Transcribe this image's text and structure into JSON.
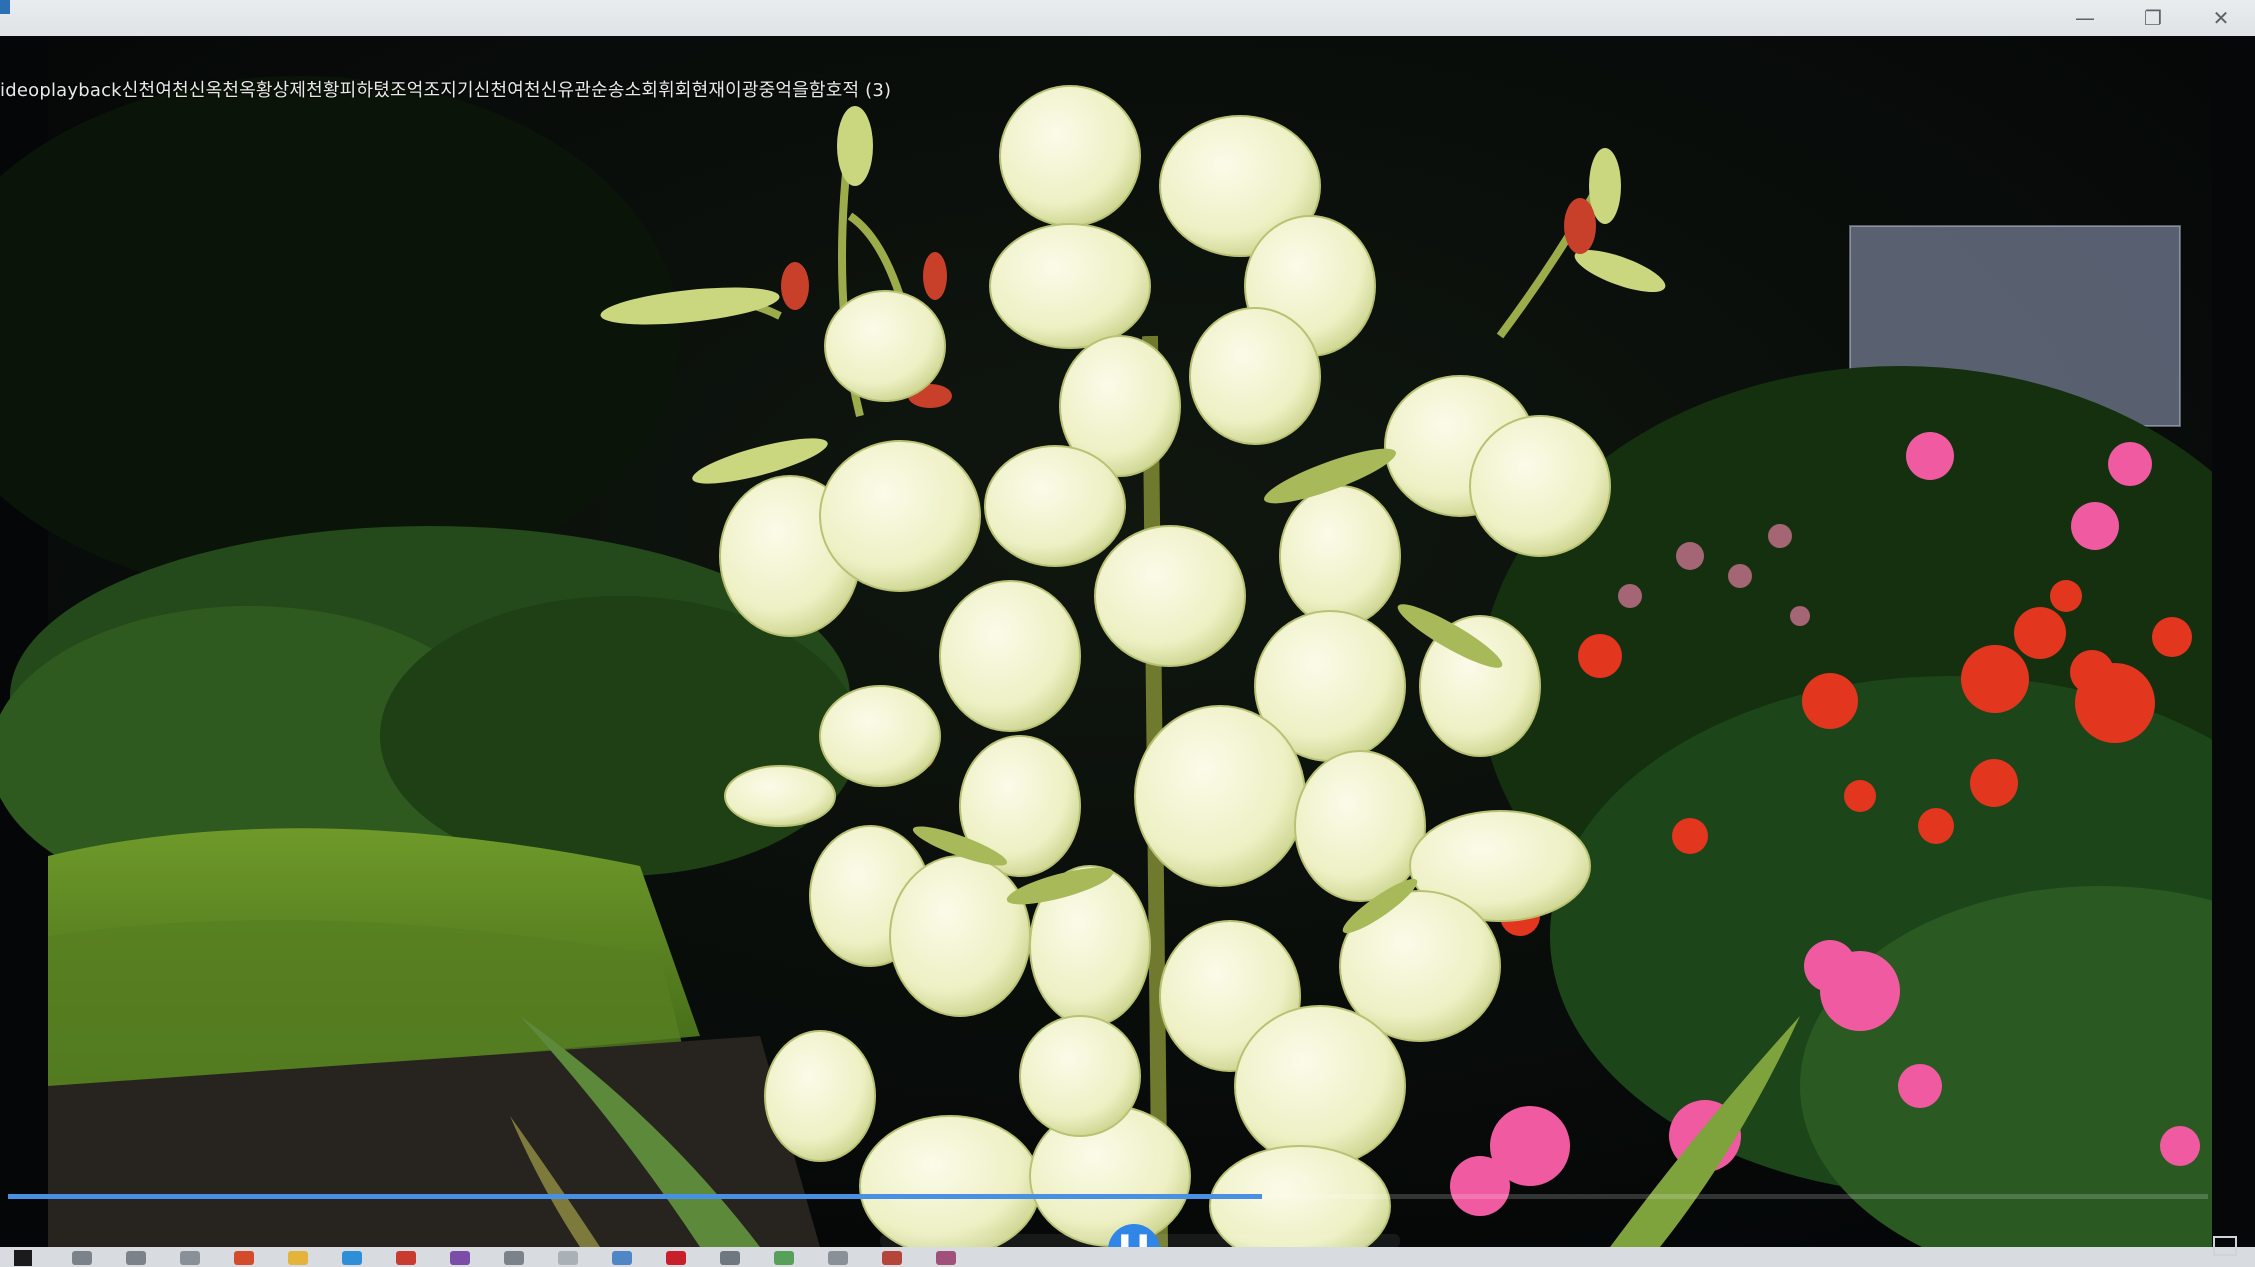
{
  "window": {
    "minimize_icon": "minimize-icon",
    "maximize_icon": "restore-icon",
    "close_icon": "close-icon",
    "minimize_glyph": "—",
    "maximize_glyph": "❐",
    "close_glyph": "✕"
  },
  "player": {
    "title": "ideoplayback신천여천신옥천옥황상제천황피하텼조억조지기신천여천신유관순송소회휘회현재이광중억을함호적 (3)",
    "progress_fraction": 0.57,
    "play_pause_icon": "pause-icon",
    "play_pause_glyph": "❚❚",
    "scene": "flowering yucca with white bell flowers in a garden, red and pink flowers on the right"
  },
  "colors": {
    "accent": "#2f86e6",
    "seek_fill": "#4a90e2",
    "titlebar": "#e3e6e9",
    "taskbar": "#d8dce0"
  },
  "taskbar": {
    "icons": [
      "windows-start-icon",
      "search-icon",
      "cortana-icon",
      "task-view-icon",
      "office-icon",
      "file-explorer-icon",
      "edge-icon",
      "gmail-icon",
      "app-icon",
      "magnifier-icon",
      "app-icon",
      "app-icon",
      "acrobat-icon",
      "app-icon",
      "app-icon",
      "app-icon",
      "app-icon",
      "media-icon"
    ]
  }
}
